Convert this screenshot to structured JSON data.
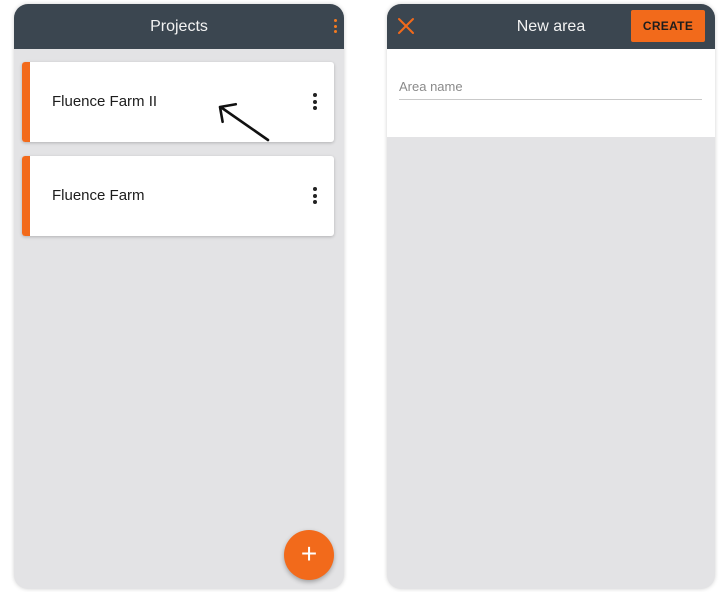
{
  "projects_screen": {
    "title": "Projects",
    "projects": [
      {
        "name": "Fluence Farm II"
      },
      {
        "name": "Fluence Farm"
      }
    ],
    "fab_label": "+"
  },
  "new_area_screen": {
    "title": "New area",
    "create_label": "CREATE",
    "area_name": {
      "value": "",
      "placeholder": "Area name"
    }
  },
  "icons": {
    "overflow_menu": "kebab-vertical-icon",
    "close": "close-x-icon",
    "pointer_arrow": "arrow-up-left-icon",
    "add": "plus-icon"
  },
  "colors": {
    "appbar": "#3b4650",
    "accent": "#f26a1b",
    "background": "#e3e3e5",
    "card": "#ffffff"
  }
}
